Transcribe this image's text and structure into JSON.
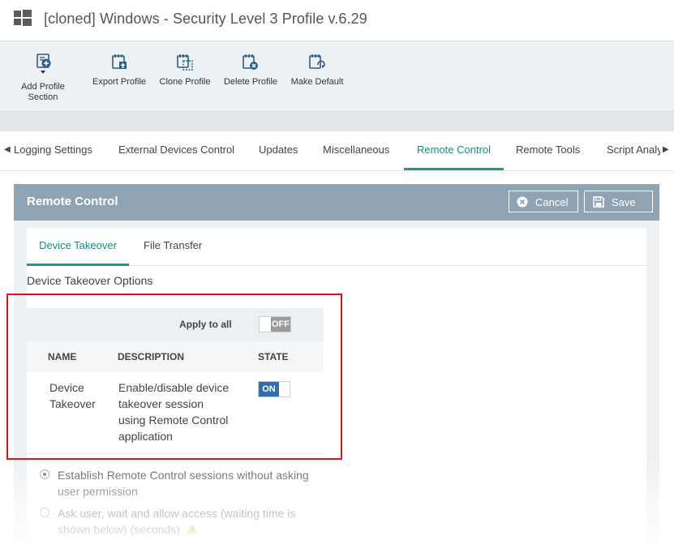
{
  "window": {
    "title": "[cloned] Windows - Security Level 3 Profile v.6.29"
  },
  "toolbar": {
    "add_profile_section": "Add Profile\nSection",
    "export_profile": "Export Profile",
    "clone_profile": "Clone Profile",
    "delete_profile": "Delete Profile",
    "make_default": "Make Default"
  },
  "tabs": {
    "items": [
      "Logging Settings",
      "External Devices Control",
      "Updates",
      "Miscellaneous",
      "Remote Control",
      "Remote Tools",
      "Script Analy"
    ],
    "active": "Remote Control"
  },
  "panel": {
    "title": "Remote Control",
    "cancel_label": "Cancel",
    "save_label": "Save"
  },
  "subtabs": {
    "items": [
      "Device Takeover",
      "File Transfer"
    ],
    "active": "Device Takeover"
  },
  "section": {
    "title": "Device Takeover Options"
  },
  "table": {
    "apply_to_all_label": "Apply to all",
    "apply_to_all_state": "OFF",
    "headers": [
      "NAME",
      "DESCRIPTION",
      "STATE"
    ],
    "rows": [
      {
        "name": "Device\nTakeover",
        "description": "Enable/disable device\ntakeover session\nusing Remote Control\napplication",
        "state": "ON"
      }
    ]
  },
  "options": {
    "establish_without_asking": "Establish Remote Control sessions without asking\nuser permission",
    "ask_user_wait": "Ask user, wait and allow access (waiting time is\nshown below)  (seconds)"
  },
  "colors": {
    "accent": "#1a9c88",
    "header": "#8fa3b2",
    "toggle_on": "#2f6fb0",
    "highlight_box": "#e0101a",
    "warning": "#f2c233"
  }
}
